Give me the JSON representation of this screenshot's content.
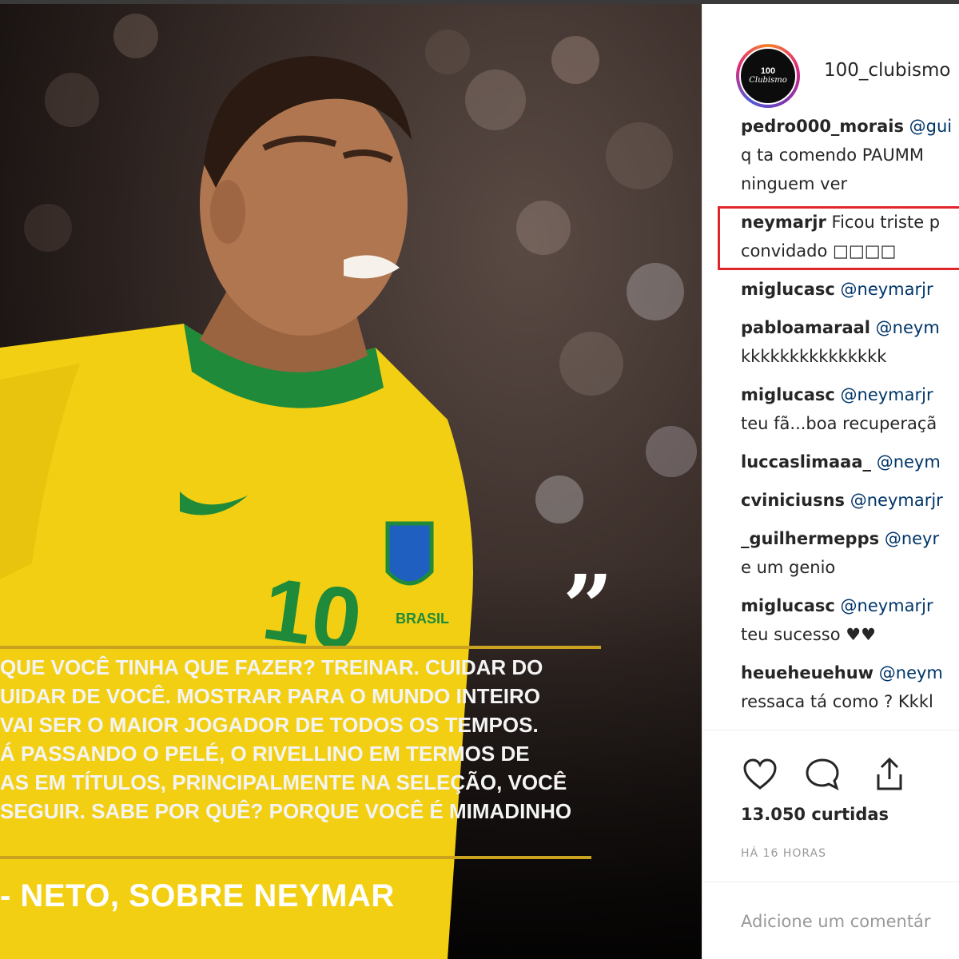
{
  "post": {
    "quote_lines": [
      "QUE VOCÊ TINHA QUE FAZER? TREINAR. CUIDAR DO",
      "UIDAR DE VOCÊ. MOSTRAR PARA O MUNDO INTEIRO",
      "VAI SER O MAIOR JOGADOR DE TODOS OS TEMPOS.",
      "Á PASSANDO O PELÉ, O RIVELLINO EM TERMOS DE",
      "AS EM TÍTULOS, PRINCIPALMENTE NA SELEÇÃO, VOCÊ",
      "SEGUIR. SABE POR QUÊ? PORQUE VOCÊ É MIMADINHO"
    ],
    "attribution": "- NETO, SOBRE NEYMAR",
    "jersey_number": "10",
    "crest_text": "BRASIL"
  },
  "header": {
    "username": "100_clubismo",
    "avatar_text_top": "100",
    "avatar_text_bottom": "Clubismo"
  },
  "comments": [
    {
      "user": "pedro000_morais",
      "mention": "@gui",
      "lines": [
        "q ta comendo PAUMM",
        "ninguem ver"
      ]
    },
    {
      "user": "neymarjr",
      "text": "Ficou triste p",
      "lines": [
        "convidado □□□□"
      ],
      "highlighted": true
    },
    {
      "user": "miglucasc",
      "mention": "@neymarjr",
      "lines": []
    },
    {
      "user": "pabloamaraal",
      "mention": "@neym",
      "lines": [
        "kkkkkkkkkkkkkkk"
      ]
    },
    {
      "user": "miglucasc",
      "mention": "@neymarjr",
      "lines": [
        "teu fã...boa recuperaçã"
      ]
    },
    {
      "user": "luccaslimaaa_",
      "mention": "@neym",
      "lines": []
    },
    {
      "user": "cviniciusns",
      "mention": "@neymarjr",
      "lines": []
    },
    {
      "user": "_guilhermepps",
      "mention": "@neyr",
      "lines": [
        "e um genio"
      ]
    },
    {
      "user": "miglucasc",
      "mention": "@neymarjr",
      "lines": [
        "teu sucesso ♥♥"
      ]
    },
    {
      "user": "heueheuehuw",
      "mention": "@neym",
      "lines": [
        "ressaca tá como ? Kkkl"
      ]
    }
  ],
  "actions": {
    "like_icon": "heart-icon",
    "comment_icon": "comment-bubble-icon",
    "share_icon": "share-icon"
  },
  "likes_text": "13.050 curtidas",
  "timestamp": "HÁ 16 HORAS",
  "comment_placeholder": "Adicione um comentár",
  "colors": {
    "accent_gold": "#c9a31f",
    "highlight_red": "#e0262b",
    "jersey_yellow": "#f2cf12",
    "jersey_green": "#1f8a3a"
  }
}
